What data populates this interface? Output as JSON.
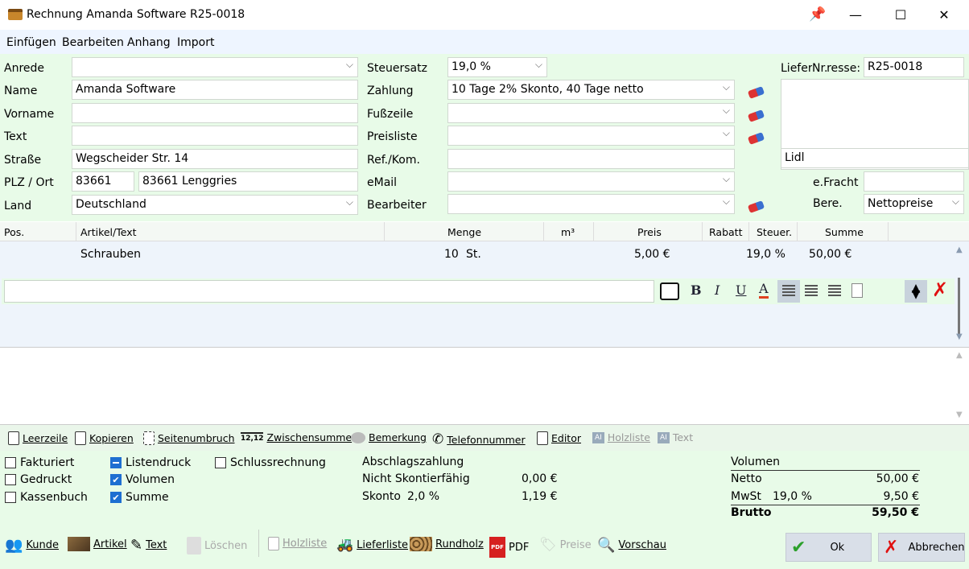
{
  "window": {
    "title": "Rechnung Amanda Software R25-0018",
    "minimize": "—",
    "maximize": "☐",
    "close": "✕"
  },
  "menu": [
    "Einfügen",
    "Bearbeiten",
    "Anhang",
    "Import"
  ],
  "form": {
    "anrede_label": "Anrede",
    "anrede_value": "",
    "name_label": "Name",
    "name_value": "Amanda Software",
    "vorname_label": "Vorname",
    "vorname_value": "",
    "text_label": "Text",
    "text_value": "",
    "strasse_label": "Straße",
    "strasse_value": "Wegscheider Str. 14",
    "plz_label": "PLZ / Ort",
    "plz_value": "83661",
    "ort_value": "83661 Lenggries",
    "land_label": "Land",
    "land_value": "Deutschland",
    "steuersatz_label": "Steuersatz",
    "steuersatz_value": "19,0 %",
    "zahlung_label": "Zahlung",
    "zahlung_value": "10 Tage 2% Skonto, 40 Tage netto",
    "fusszeile_label": "Fußzeile",
    "fusszeile_value": "",
    "preisliste_label": "Preisliste",
    "preisliste_value": "",
    "refkom_label": "Ref./Kom.",
    "refkom_value": "",
    "email_label": "eMail",
    "email_value": "",
    "bearbeiter_label": "Bearbeiter",
    "bearbeiter_value": "",
    "lieferadresse_label": "Lieferadresse:",
    "nr_label": "Nr.",
    "nr_value": "R25-0018",
    "lieferadresse_value": "Lidl",
    "efracht_label": "e.Fracht",
    "efracht_value": "",
    "bere_label": "Bere.",
    "bere_value": "Nettopreise"
  },
  "table": {
    "headers": {
      "pos": "Pos.",
      "artikel": "Artikel/Text",
      "menge": "Menge",
      "m3": "m³",
      "preis": "Preis",
      "rabatt": "Rabatt",
      "steuer": "Steuer.",
      "summe": "Summe"
    },
    "rows": [
      {
        "artikel": "Schrauben",
        "menge": "10",
        "einheit": "St.",
        "preis": "5,00 €",
        "steuer": "19,0 %",
        "summe": "50,00 €"
      }
    ]
  },
  "editor": {
    "bold": "B",
    "italic": "I",
    "underline": "U",
    "color": "A",
    "delete": "✗"
  },
  "actions": {
    "leerzeile": "Leerzeile",
    "kopieren": "Kopieren",
    "seitenumbruch": "Seitenumbruch",
    "zwischensumme_icon": "12,12",
    "zwischensumme": "Zwischensumme",
    "bemerkung": "Bemerkung",
    "telefonnummer": "Telefonnummer",
    "editor": "Editor",
    "holzliste": "Holzliste",
    "text": "Text"
  },
  "options": {
    "fakturiert": "Fakturiert",
    "gedruckt": "Gedruckt",
    "kassenbuch": "Kassenbuch",
    "listendruck": "Listendruck",
    "volumen": "Volumen",
    "summe": "Summe",
    "schlussrechnung": "Schlussrechnung"
  },
  "abschlag": {
    "title": "Abschlagszahlung",
    "nicht_label": "Nicht Skontierfähig",
    "nicht_value": "0,00 €",
    "skonto_label": "Skonto",
    "skonto_pct": "2,0 %",
    "skonto_value": "1,19 €"
  },
  "totals": {
    "title": "Volumen",
    "netto_label": "Netto",
    "netto_value": "50,00 €",
    "mwst_label": "MwSt",
    "mwst_pct": "19,0 %",
    "mwst_value": "9,50 €",
    "brutto_label": "Brutto",
    "brutto_value": "59,50 €"
  },
  "bottom": {
    "kunde": "Kunde",
    "artikel": "Artikel",
    "text": "Text",
    "loeschen": "Löschen",
    "holzliste": "Holzliste",
    "lieferliste": "Lieferliste",
    "rundholz": "Rundholz",
    "pdf": "PDF",
    "pdf_icon": "PDF",
    "preise": "Preise",
    "vorschau": "Vorschau",
    "ok": "Ok",
    "abbrechen": "Abbrechen"
  },
  "colors": {
    "panel": "#e8fbe8",
    "menu": "#eef5ff",
    "accent": "#1e6fd1"
  }
}
